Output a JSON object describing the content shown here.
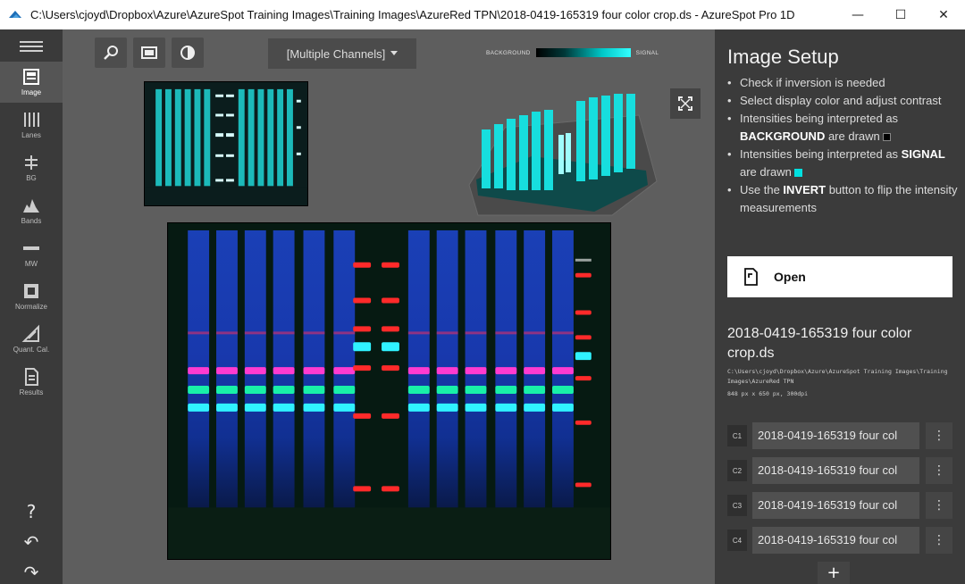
{
  "window": {
    "title": "C:\\Users\\cjoyd\\Dropbox\\Azure\\AzureSpot Training Images\\Training Images\\AzureRed TPN\\2018-0419-165319 four color crop.ds - AzureSpot Pro 1D",
    "minimize": "—",
    "maximize": "☐",
    "close": "✕"
  },
  "sidebar": {
    "items": [
      {
        "label": "Image",
        "icon": "image-icon",
        "active": true
      },
      {
        "label": "Lanes",
        "icon": "lanes-icon"
      },
      {
        "label": "BG",
        "icon": "background-icon"
      },
      {
        "label": "Bands",
        "icon": "bands-icon"
      },
      {
        "label": "MW",
        "icon": "molecular-weight-icon"
      },
      {
        "label": "Normalize",
        "icon": "normalize-icon"
      },
      {
        "label": "Quant. Cal.",
        "icon": "quant-cal-icon"
      },
      {
        "label": "Results",
        "icon": "results-icon"
      }
    ],
    "help": "?",
    "undo": "↶",
    "redo": "↷"
  },
  "toolbar": {
    "channel_select": "[Multiple Channels]",
    "colorbar_low": "BACKGROUND",
    "colorbar_high": "SIGNAL"
  },
  "panel": {
    "title": "Image Setup",
    "bullets": {
      "b1": "Check if inversion is needed",
      "b2": "Select display color and adjust contrast",
      "b3_pre": "Intensities being interpreted as ",
      "b3_bold": "BACKGROUND",
      "b3_post": " are drawn",
      "b4_pre": "Intensities being interpreted as ",
      "b4_bold": "SIGNAL",
      "b4_post": " are drawn",
      "b5_pre": "Use the ",
      "b5_bold": "INVERT",
      "b5_post": " button to flip the intensity measurements"
    },
    "open_label": "Open",
    "file_title": "2018-0419-165319 four color crop.ds",
    "file_path": "C:\\Users\\cjoyd\\Dropbox\\Azure\\AzureSpot Training Images\\Training Images\\AzureRed TPN",
    "file_dims": "848 px x 650 px, 300dpi",
    "channels": [
      {
        "badge": "C1",
        "name": "2018-0419-165319 four col"
      },
      {
        "badge": "C2",
        "name": "2018-0419-165319 four col"
      },
      {
        "badge": "C3",
        "name": "2018-0419-165319 four col"
      },
      {
        "badge": "C4",
        "name": "2018-0419-165319 four col"
      }
    ],
    "more": "⋮",
    "add": "+"
  },
  "colors": {
    "accent_cyan": "#00e0e0",
    "panel_bg": "#3b3b3b",
    "sidebar_bg": "#3a3a3a"
  }
}
